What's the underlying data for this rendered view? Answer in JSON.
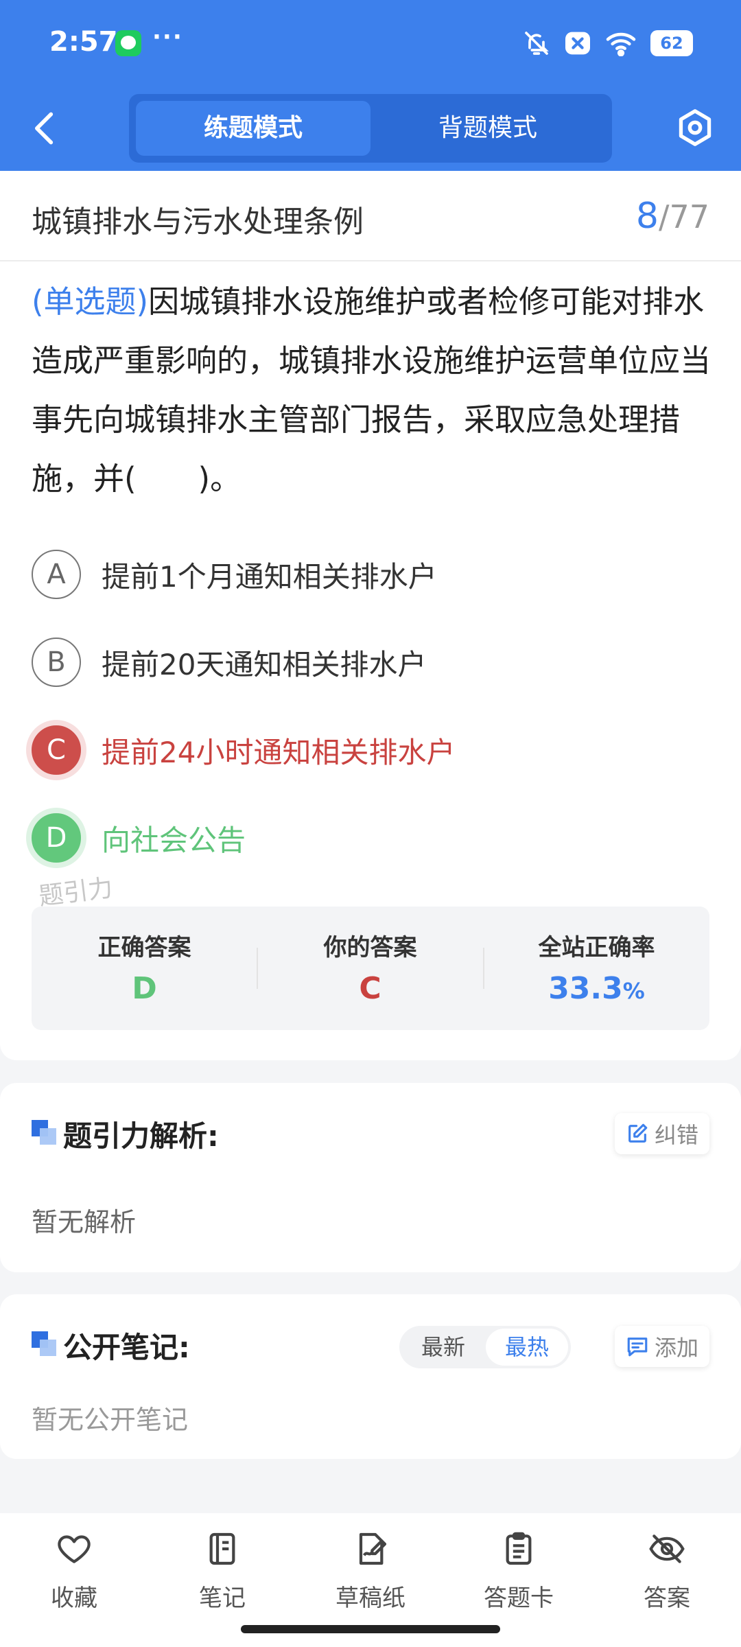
{
  "status_bar": {
    "time": "2:57",
    "more": "···",
    "battery": "62"
  },
  "nav": {
    "tab_practice": "练题模式",
    "tab_memorize": "背题模式"
  },
  "header": {
    "title": "城镇排水与污水处理条例",
    "current": "8",
    "sep": "/",
    "total": "77"
  },
  "question": {
    "type": "(单选题)",
    "text": "因城镇排水设施维护或者检修可能对排水造成严重影响的，城镇排水设施维护运营单位应当事先向城镇排水主管部门报告，采取应急处理措施，并(　　)。"
  },
  "options": [
    {
      "letter": "A",
      "text": "提前1个月通知相关排水户"
    },
    {
      "letter": "B",
      "text": "提前20天通知相关排水户"
    },
    {
      "letter": "C",
      "text": "提前24小时通知相关排水户"
    },
    {
      "letter": "D",
      "text": "向社会公告"
    }
  ],
  "watermark": "题引力",
  "stats": {
    "correct_label": "正确答案",
    "correct_value": "D",
    "yours_label": "你的答案",
    "yours_value": "C",
    "rate_label": "全站正确率",
    "rate_value": "33.3",
    "rate_unit": "%"
  },
  "analysis": {
    "title": "题引力解析:",
    "report_label": "纠错",
    "empty": "暂无解析"
  },
  "notes": {
    "title": "公开笔记:",
    "sort_new": "最新",
    "sort_hot": "最热",
    "add_label": "添加",
    "empty": "暂无公开笔记"
  },
  "tabbar": [
    {
      "label": "收藏",
      "icon": "heart-icon"
    },
    {
      "label": "笔记",
      "icon": "notebook-icon"
    },
    {
      "label": "草稿纸",
      "icon": "draft-icon"
    },
    {
      "label": "答题卡",
      "icon": "clipboard-icon"
    },
    {
      "label": "答案",
      "icon": "eye-off-icon"
    }
  ],
  "colors": {
    "primary": "#3d80ec",
    "wrong": "#cd4e4b",
    "right": "#62c87c"
  }
}
